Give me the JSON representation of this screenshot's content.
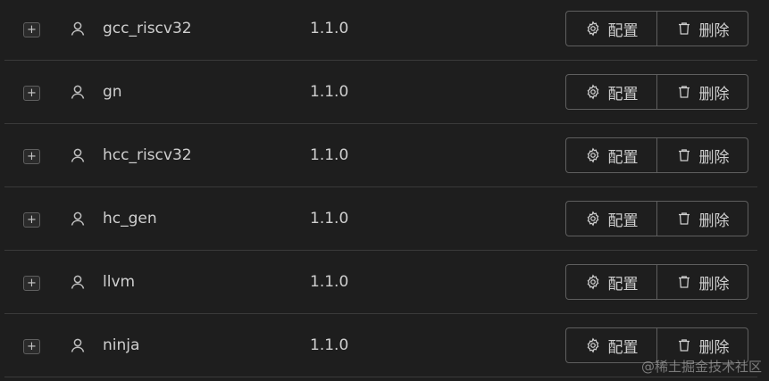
{
  "rows": [
    {
      "name": "gcc_riscv32",
      "version": "1.1.0"
    },
    {
      "name": "gn",
      "version": "1.1.0"
    },
    {
      "name": "hcc_riscv32",
      "version": "1.1.0"
    },
    {
      "name": "hc_gen",
      "version": "1.1.0"
    },
    {
      "name": "llvm",
      "version": "1.1.0"
    },
    {
      "name": "ninja",
      "version": "1.1.0"
    }
  ],
  "actions": {
    "expand_label": "+",
    "config_label": "配置",
    "delete_label": "删除"
  },
  "icons": {
    "expand": "plus-icon",
    "user": "user-icon",
    "config": "gear-icon",
    "delete": "trash-icon"
  },
  "watermark": "@稀土掘金技术社区",
  "colors": {
    "background": "#1e1e1e",
    "text": "#cfcfcf",
    "border": "#5f5f5f"
  }
}
